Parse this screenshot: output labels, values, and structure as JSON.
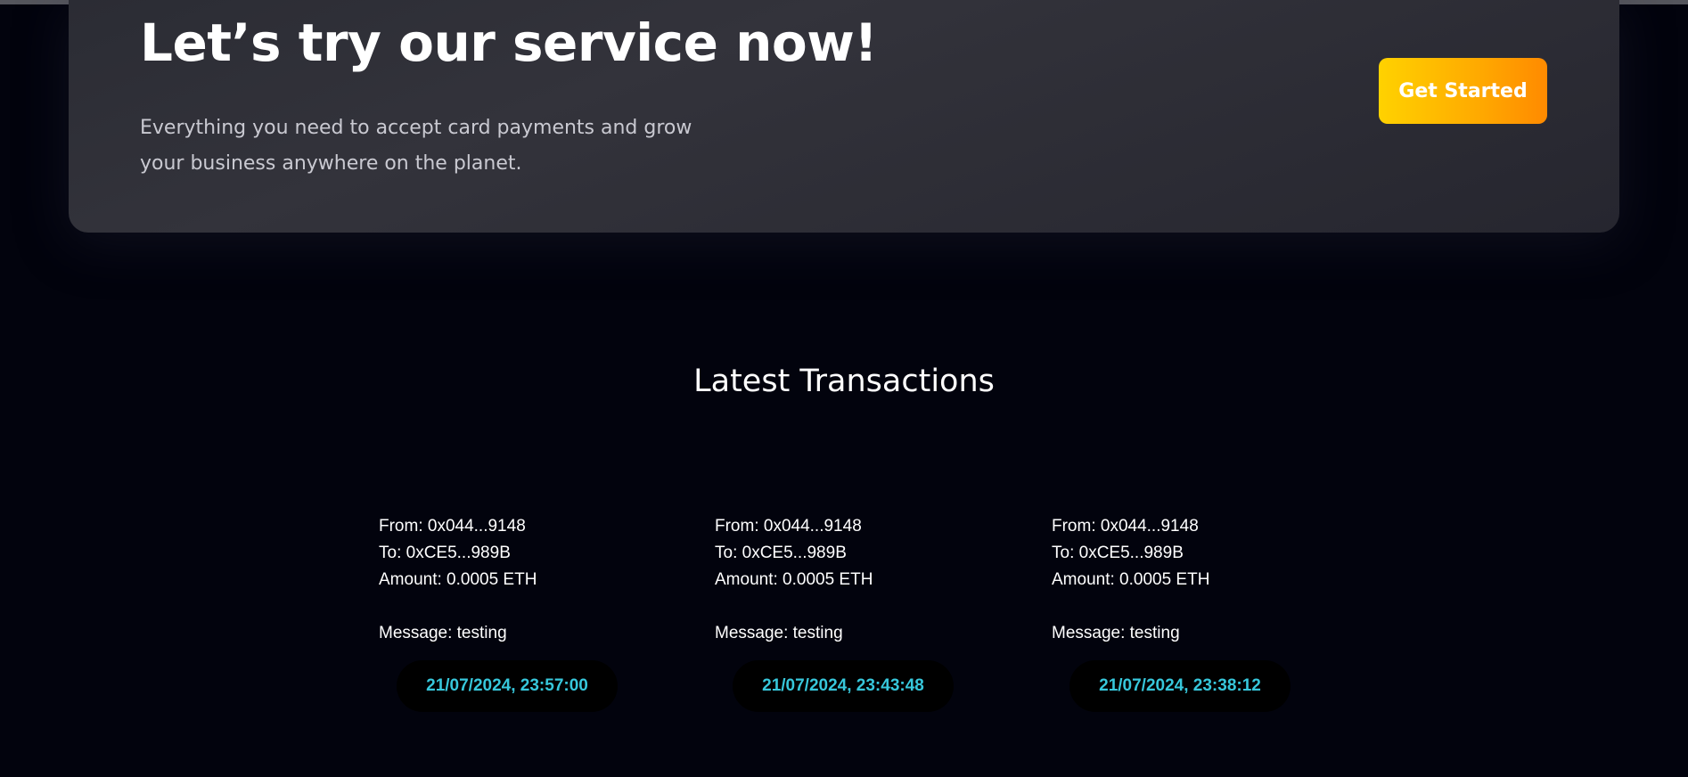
{
  "cta": {
    "title": "Let’s try our service now!",
    "subtitle": "Everything you need to accept card payments and grow your business anywhere on the planet.",
    "button_label": "Get Started"
  },
  "transactions_section": {
    "title": "Latest Transactions",
    "items": [
      {
        "from": "From: 0x044...9148",
        "to": "To: 0xCE5...989B",
        "amount": "Amount: 0.0005 ETH",
        "message": "Message: testing",
        "timestamp": "21/07/2024, 23:57:00"
      },
      {
        "from": "From: 0x044...9148",
        "to": "To: 0xCE5...989B",
        "amount": "Amount: 0.0005 ETH",
        "message": "Message: testing",
        "timestamp": "21/07/2024, 23:43:48"
      },
      {
        "from": "From: 0x044...9148",
        "to": "To: 0xCE5...989B",
        "amount": "Amount: 0.0005 ETH",
        "message": "Message: testing",
        "timestamp": "21/07/2024, 23:38:12"
      }
    ]
  },
  "colors": {
    "page_background": "#02030d",
    "card_background": "#2d2d35",
    "button_gradient_start": "#ffd200",
    "button_gradient_end": "#ff8a00",
    "timestamp_text": "#37c7db"
  }
}
